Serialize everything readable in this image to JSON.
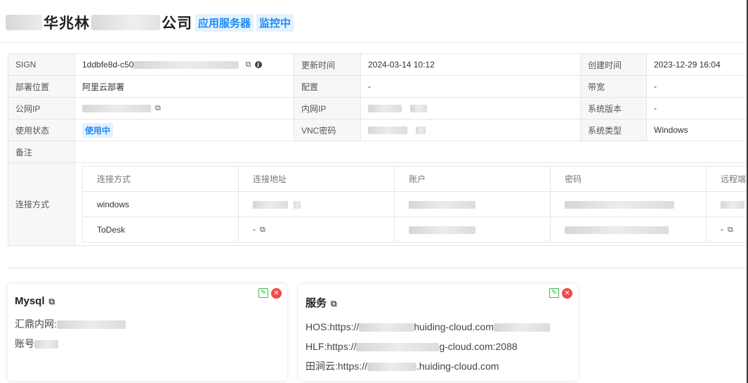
{
  "header": {
    "title": "华兆林",
    "title_suffix": "公司",
    "tags": [
      "应用服务器",
      "监控中"
    ]
  },
  "info": {
    "sign": {
      "label": "SIGN",
      "value": "1ddbfe8d-c50"
    },
    "updated": {
      "label": "更新时间",
      "value": "2024-03-14 10:12"
    },
    "created": {
      "label": "创建时间",
      "value": "2023-12-29 16:04"
    },
    "deploy": {
      "label": "部署位置",
      "value": "阿里云部署"
    },
    "config": {
      "label": "配置",
      "value": "-"
    },
    "bandwidth": {
      "label": "带宽",
      "value": "-"
    },
    "public_ip": {
      "label": "公网IP",
      "value": ""
    },
    "private_ip": {
      "label": "内网IP",
      "value": ""
    },
    "os_version": {
      "label": "系统版本",
      "value": "-"
    },
    "status": {
      "label": "使用状态",
      "value": "使用中"
    },
    "vnc": {
      "label": "VNC密码",
      "value": ""
    },
    "os_type": {
      "label": "系统类型",
      "value": "Windows"
    },
    "remark": {
      "label": "备注",
      "value": ""
    },
    "connection": {
      "label": "连接方式",
      "columns": [
        "连接方式",
        "连接地址",
        "账户",
        "密码",
        "远程端"
      ],
      "rows": [
        {
          "method": "windows",
          "address": "",
          "account": "",
          "password": "",
          "remote": ""
        },
        {
          "method": "ToDesk",
          "address": "-",
          "account": "",
          "password": "",
          "remote": "-"
        }
      ]
    }
  },
  "cards": {
    "mysql": {
      "title": "Mysql",
      "lines": [
        "汇鼎内网:",
        "账号"
      ]
    },
    "service": {
      "title": "服务",
      "lines": [
        {
          "prefix": "HOS:https://",
          "suffix": "huiding-cloud.com"
        },
        {
          "prefix": "HLF:https://",
          "suffix": "g-cloud.com:2088"
        },
        {
          "prefix": "田涧云:https://",
          "suffix": ".huiding-cloud.com"
        }
      ]
    }
  },
  "icons": {
    "copy": "copy-icon",
    "info": "info-icon",
    "edit": "edit-icon",
    "delete": "delete-icon"
  },
  "colors": {
    "tag_bg": "#e4f2ff",
    "tag_text": "#1d8cf2",
    "edit": "#3db74f",
    "delete": "#ee4a4a"
  }
}
